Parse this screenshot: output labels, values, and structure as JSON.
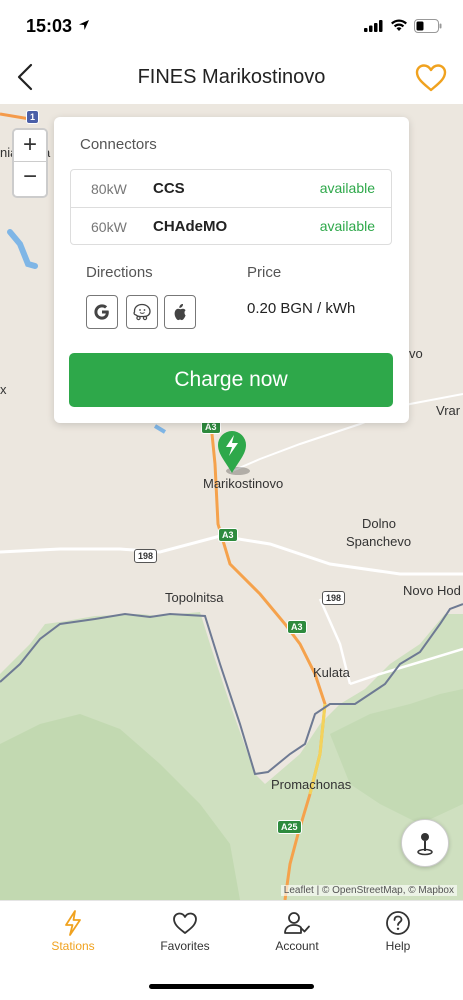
{
  "status_bar": {
    "time": "15:03"
  },
  "nav": {
    "title": "FINES Marikostinovo"
  },
  "colors": {
    "accent": "#f0a21f",
    "primary_green": "#2ea84a",
    "status_available": "#2ea84a"
  },
  "station_card": {
    "connectors_heading": "Connectors",
    "connectors": [
      {
        "power": "80kW",
        "type": "CCS",
        "status": "available"
      },
      {
        "power": "60kW",
        "type": "CHAdeMO",
        "status": "available"
      }
    ],
    "directions_heading": "Directions",
    "direction_apps": [
      "google-maps-icon",
      "waze-icon",
      "apple-maps-icon"
    ],
    "price_heading": "Price",
    "price_value": "0.20 BGN / kWh",
    "charge_button": "Charge now"
  },
  "map": {
    "zoom_in": "+",
    "zoom_out": "−",
    "labels": {
      "marikostinovo": "Marikostinovo",
      "dolno": "Dolno",
      "spanchevo": "Spanchevo",
      "topolnitsa": "Topolnitsa",
      "novo_hod": "Novo Hod",
      "kulata": "Kulata",
      "promachonas": "Promachonas",
      "vra": "Vrar",
      "vo": "vo",
      "nia": "nia",
      "a": "a",
      "x": "x"
    },
    "road_badges": {
      "a3_1": "A3",
      "a3_2": "A3",
      "a3_3": "A3",
      "r198_1": "198",
      "r198_2": "198",
      "a25": "A25",
      "r1": "1"
    },
    "attribution": "Leaflet | © OpenStreetMap, © Mapbox"
  },
  "tabs": [
    {
      "label": "Stations",
      "icon": "lightning-icon",
      "active": true
    },
    {
      "label": "Favorites",
      "icon": "heart-icon",
      "active": false
    },
    {
      "label": "Account",
      "icon": "account-icon",
      "active": false
    },
    {
      "label": "Help",
      "icon": "help-icon",
      "active": false
    }
  ]
}
